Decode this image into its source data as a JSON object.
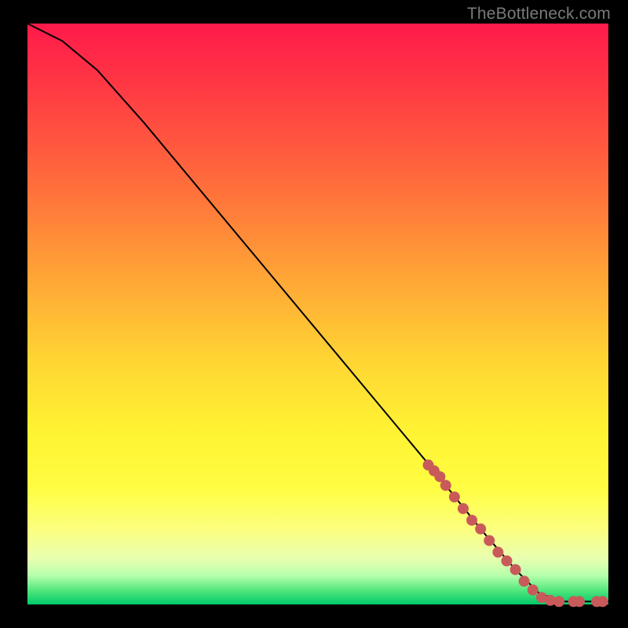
{
  "watermark": "TheBottleneck.com",
  "colors": {
    "curve": "#000000",
    "dot": "#c95a5a",
    "frame_bg": "#000000"
  },
  "chart_data": {
    "type": "line",
    "title": "",
    "xlabel": "",
    "ylabel": "",
    "xlim": [
      0,
      100
    ],
    "ylim": [
      0,
      100
    ],
    "grid": false,
    "legend": false,
    "series": [
      {
        "name": "curve",
        "kind": "line",
        "points": [
          {
            "x": 0,
            "y": 100
          },
          {
            "x": 6,
            "y": 97
          },
          {
            "x": 12,
            "y": 92
          },
          {
            "x": 20,
            "y": 83
          },
          {
            "x": 30,
            "y": 71
          },
          {
            "x": 40,
            "y": 59
          },
          {
            "x": 50,
            "y": 47
          },
          {
            "x": 60,
            "y": 35
          },
          {
            "x": 70,
            "y": 23
          },
          {
            "x": 78,
            "y": 13
          },
          {
            "x": 84,
            "y": 6
          },
          {
            "x": 88,
            "y": 2
          },
          {
            "x": 92,
            "y": 0.5
          },
          {
            "x": 100,
            "y": 0.5
          }
        ]
      },
      {
        "name": "highlighted-range",
        "kind": "scatter",
        "points": [
          {
            "x": 69,
            "y": 24
          },
          {
            "x": 70,
            "y": 23
          },
          {
            "x": 71,
            "y": 22
          },
          {
            "x": 72,
            "y": 20.5
          },
          {
            "x": 73.5,
            "y": 18.5
          },
          {
            "x": 75,
            "y": 16.5
          },
          {
            "x": 76.5,
            "y": 14.5
          },
          {
            "x": 78,
            "y": 13
          },
          {
            "x": 79.5,
            "y": 11
          },
          {
            "x": 81,
            "y": 9
          },
          {
            "x": 82.5,
            "y": 7.5
          },
          {
            "x": 84,
            "y": 6
          },
          {
            "x": 85.5,
            "y": 4
          },
          {
            "x": 87,
            "y": 2.5
          },
          {
            "x": 88.5,
            "y": 1.2
          },
          {
            "x": 90,
            "y": 0.7
          },
          {
            "x": 91.5,
            "y": 0.5
          },
          {
            "x": 94,
            "y": 0.5
          },
          {
            "x": 95,
            "y": 0.5
          },
          {
            "x": 98,
            "y": 0.5
          },
          {
            "x": 99,
            "y": 0.5
          }
        ]
      }
    ]
  }
}
